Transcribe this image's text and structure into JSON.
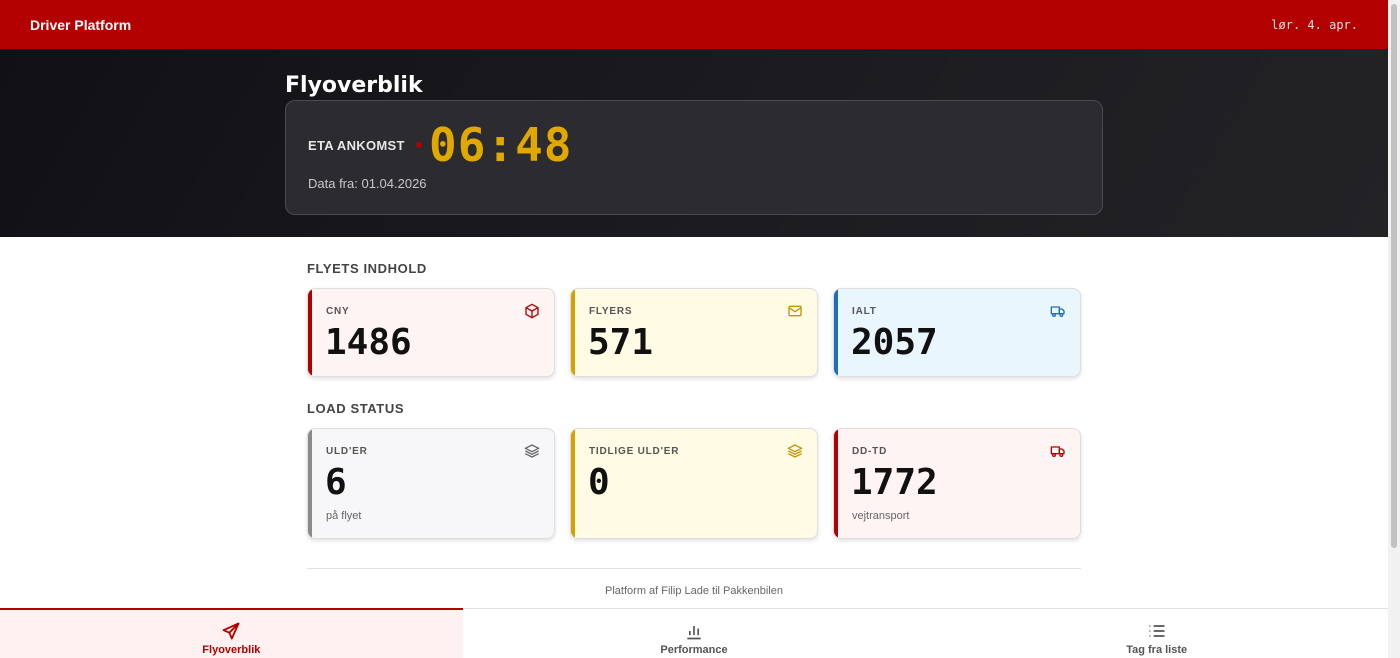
{
  "header": {
    "brand": "Driver Platform",
    "date": "lør. 4. apr."
  },
  "hero": {
    "title": "Flyoverblik",
    "eta_label": "ETA ANKOMST",
    "eta_time": "06:48",
    "source": "Data fra: 01.04.2026"
  },
  "sections": {
    "contents_title": "FLYETS INDHOLD",
    "load_title": "LOAD STATUS"
  },
  "contents": [
    {
      "label": "CNY",
      "value": "1486",
      "icon": "package-icon",
      "color": "#b30000"
    },
    {
      "label": "FLYERS",
      "value": "571",
      "icon": "envelope-icon",
      "color": "#d4a300"
    },
    {
      "label": "IALT",
      "value": "2057",
      "icon": "truck-icon",
      "color": "#1e6fb8"
    }
  ],
  "load": [
    {
      "label": "ULD'ER",
      "value": "6",
      "sub": "på flyet",
      "icon": "layers-icon",
      "color": "#8a8a8a"
    },
    {
      "label": "TIDLIGE ULD'ER",
      "value": "0",
      "sub": "",
      "icon": "layers-icon",
      "color": "#d4a300"
    },
    {
      "label": "DD-TD",
      "value": "1772",
      "sub": "vejtransport",
      "icon": "truck-icon",
      "color": "#b30000"
    }
  ],
  "footer": {
    "text": "Platform af Filip Lade til Pakkenbilen"
  },
  "nav": [
    {
      "label": "Flyoverblik",
      "icon": "plane-icon",
      "active": true
    },
    {
      "label": "Performance",
      "icon": "bar-chart-icon",
      "active": false
    },
    {
      "label": "Tag fra liste",
      "icon": "list-icon",
      "active": false
    }
  ]
}
